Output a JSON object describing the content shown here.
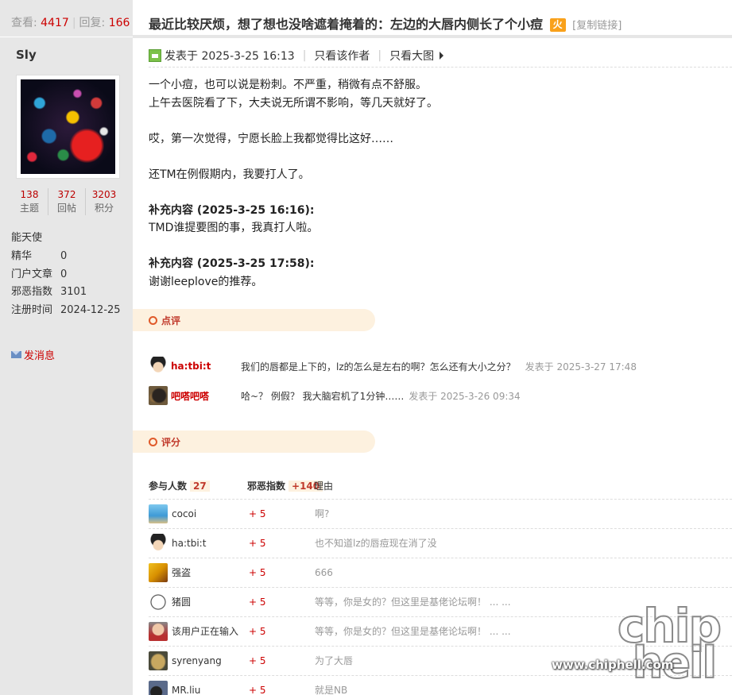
{
  "header": {
    "views_label": "查看:",
    "views": "4417",
    "replies_label": "回复:",
    "replies": "166",
    "title": "最近比较厌烦，想了想也没啥遮着掩着的：左边的大唇内侧长了个小痘",
    "hot_icon": "火",
    "copy_link": "[复制链接]"
  },
  "author": {
    "name": "Sly",
    "stats": [
      {
        "value": "138",
        "label": "主题"
      },
      {
        "value": "372",
        "label": "回帖"
      },
      {
        "value": "3203",
        "label": "积分"
      }
    ],
    "rank": "能天使",
    "profile": [
      {
        "label": "精华",
        "value": "0"
      },
      {
        "label": "门户文章",
        "value": "0"
      },
      {
        "label": "邪恶指数",
        "value": "3101"
      },
      {
        "label": "注册时间",
        "value": "2024-12-25"
      }
    ],
    "send_message": "发消息"
  },
  "post": {
    "posted_at": "发表于 2025-3-25 16:13",
    "only_author": "只看该作者",
    "large_images": "只看大图",
    "lines": [
      "一个小痘，也可以说是粉刺。不严重，稍微有点不舒服。",
      "上午去医院看了下，大夫说无所谓不影响，等几天就好了。",
      "哎，第一次觉得，宁愿长脸上我都觉得比这好……",
      "还TM在例假期内，我要打人了。"
    ],
    "supplements": [
      {
        "title": "补充内容 (2025-3-25 16:16):",
        "text": "TMD谁提要图的事，我真打人啦。"
      },
      {
        "title": "补充内容 (2025-3-25 17:58):",
        "text": "谢谢leeplove的推荐。"
      }
    ]
  },
  "comments": {
    "heading": "点评",
    "items": [
      {
        "user": "ha:tbi:t",
        "text": "我们的唇都是上下的，lz的怎么是左右的啊？怎么还有大小之分？",
        "time": "发表于 2025-3-27 17:48"
      },
      {
        "user": "吧嗒吧嗒",
        "text": "哈~？ 例假？ 我大脑宕机了1分钟……",
        "time": "发表于 2025-3-26 09:34"
      }
    ]
  },
  "rating": {
    "heading": "评分",
    "participants_label": "参与人数",
    "participants": "27",
    "index_label": "邪恶指数",
    "index_total": "+140",
    "reason_label": "理由",
    "rows": [
      {
        "user": "cocoi",
        "score": "+ 5",
        "reason": "啊?"
      },
      {
        "user": "ha:tbi:t",
        "score": "+ 5",
        "reason": "也不知道lz的唇痘现在消了没"
      },
      {
        "user": "强盗",
        "score": "+ 5",
        "reason": "666"
      },
      {
        "user": "猪圆",
        "score": "+ 5",
        "reason": "等等，你是女的？但这里是基佬论坛啊！ ... ..."
      },
      {
        "user": "该用户正在输入",
        "score": "+ 5",
        "reason": "等等，你是女的？但这里是基佬论坛啊！ ... ..."
      },
      {
        "user": "syrenyang",
        "score": "+ 5",
        "reason": "为了大唇"
      },
      {
        "user": "MR.liu",
        "score": "+ 5",
        "reason": "就是NB"
      }
    ]
  },
  "watermark": {
    "logo_top": "chip",
    "logo_bottom": "hell",
    "url": "www.chiphell.com"
  },
  "colors": {
    "accent_red": "#cc0000",
    "section_bg": "#fdf1df",
    "left_bg": "#e7e7e7"
  }
}
